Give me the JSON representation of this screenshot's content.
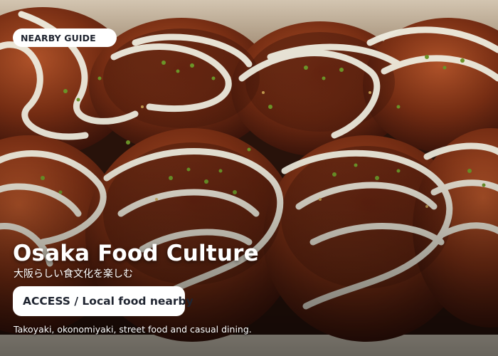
{
  "badge": {
    "label": "NEARBY GUIDE"
  },
  "hero": {
    "title": "Osaka Food Culture",
    "subtitle": "大阪らしい食文化を楽しむ",
    "image_subject": "takoyaki-with-mayonnaise-and-aonori"
  },
  "access_button": {
    "label": "ACCESS / Local food nearby"
  },
  "description": "Takoyaki, okonomiyaki, street food and casual dining.",
  "colors": {
    "text_primary": "#ffffff",
    "pill_background": "#ffffff",
    "pill_text": "#1f2430",
    "takoyaki": "#8a3a18",
    "sauce": "#3a1208",
    "mayo": "#f6f4e6",
    "aonori": "#6f9a2a"
  }
}
